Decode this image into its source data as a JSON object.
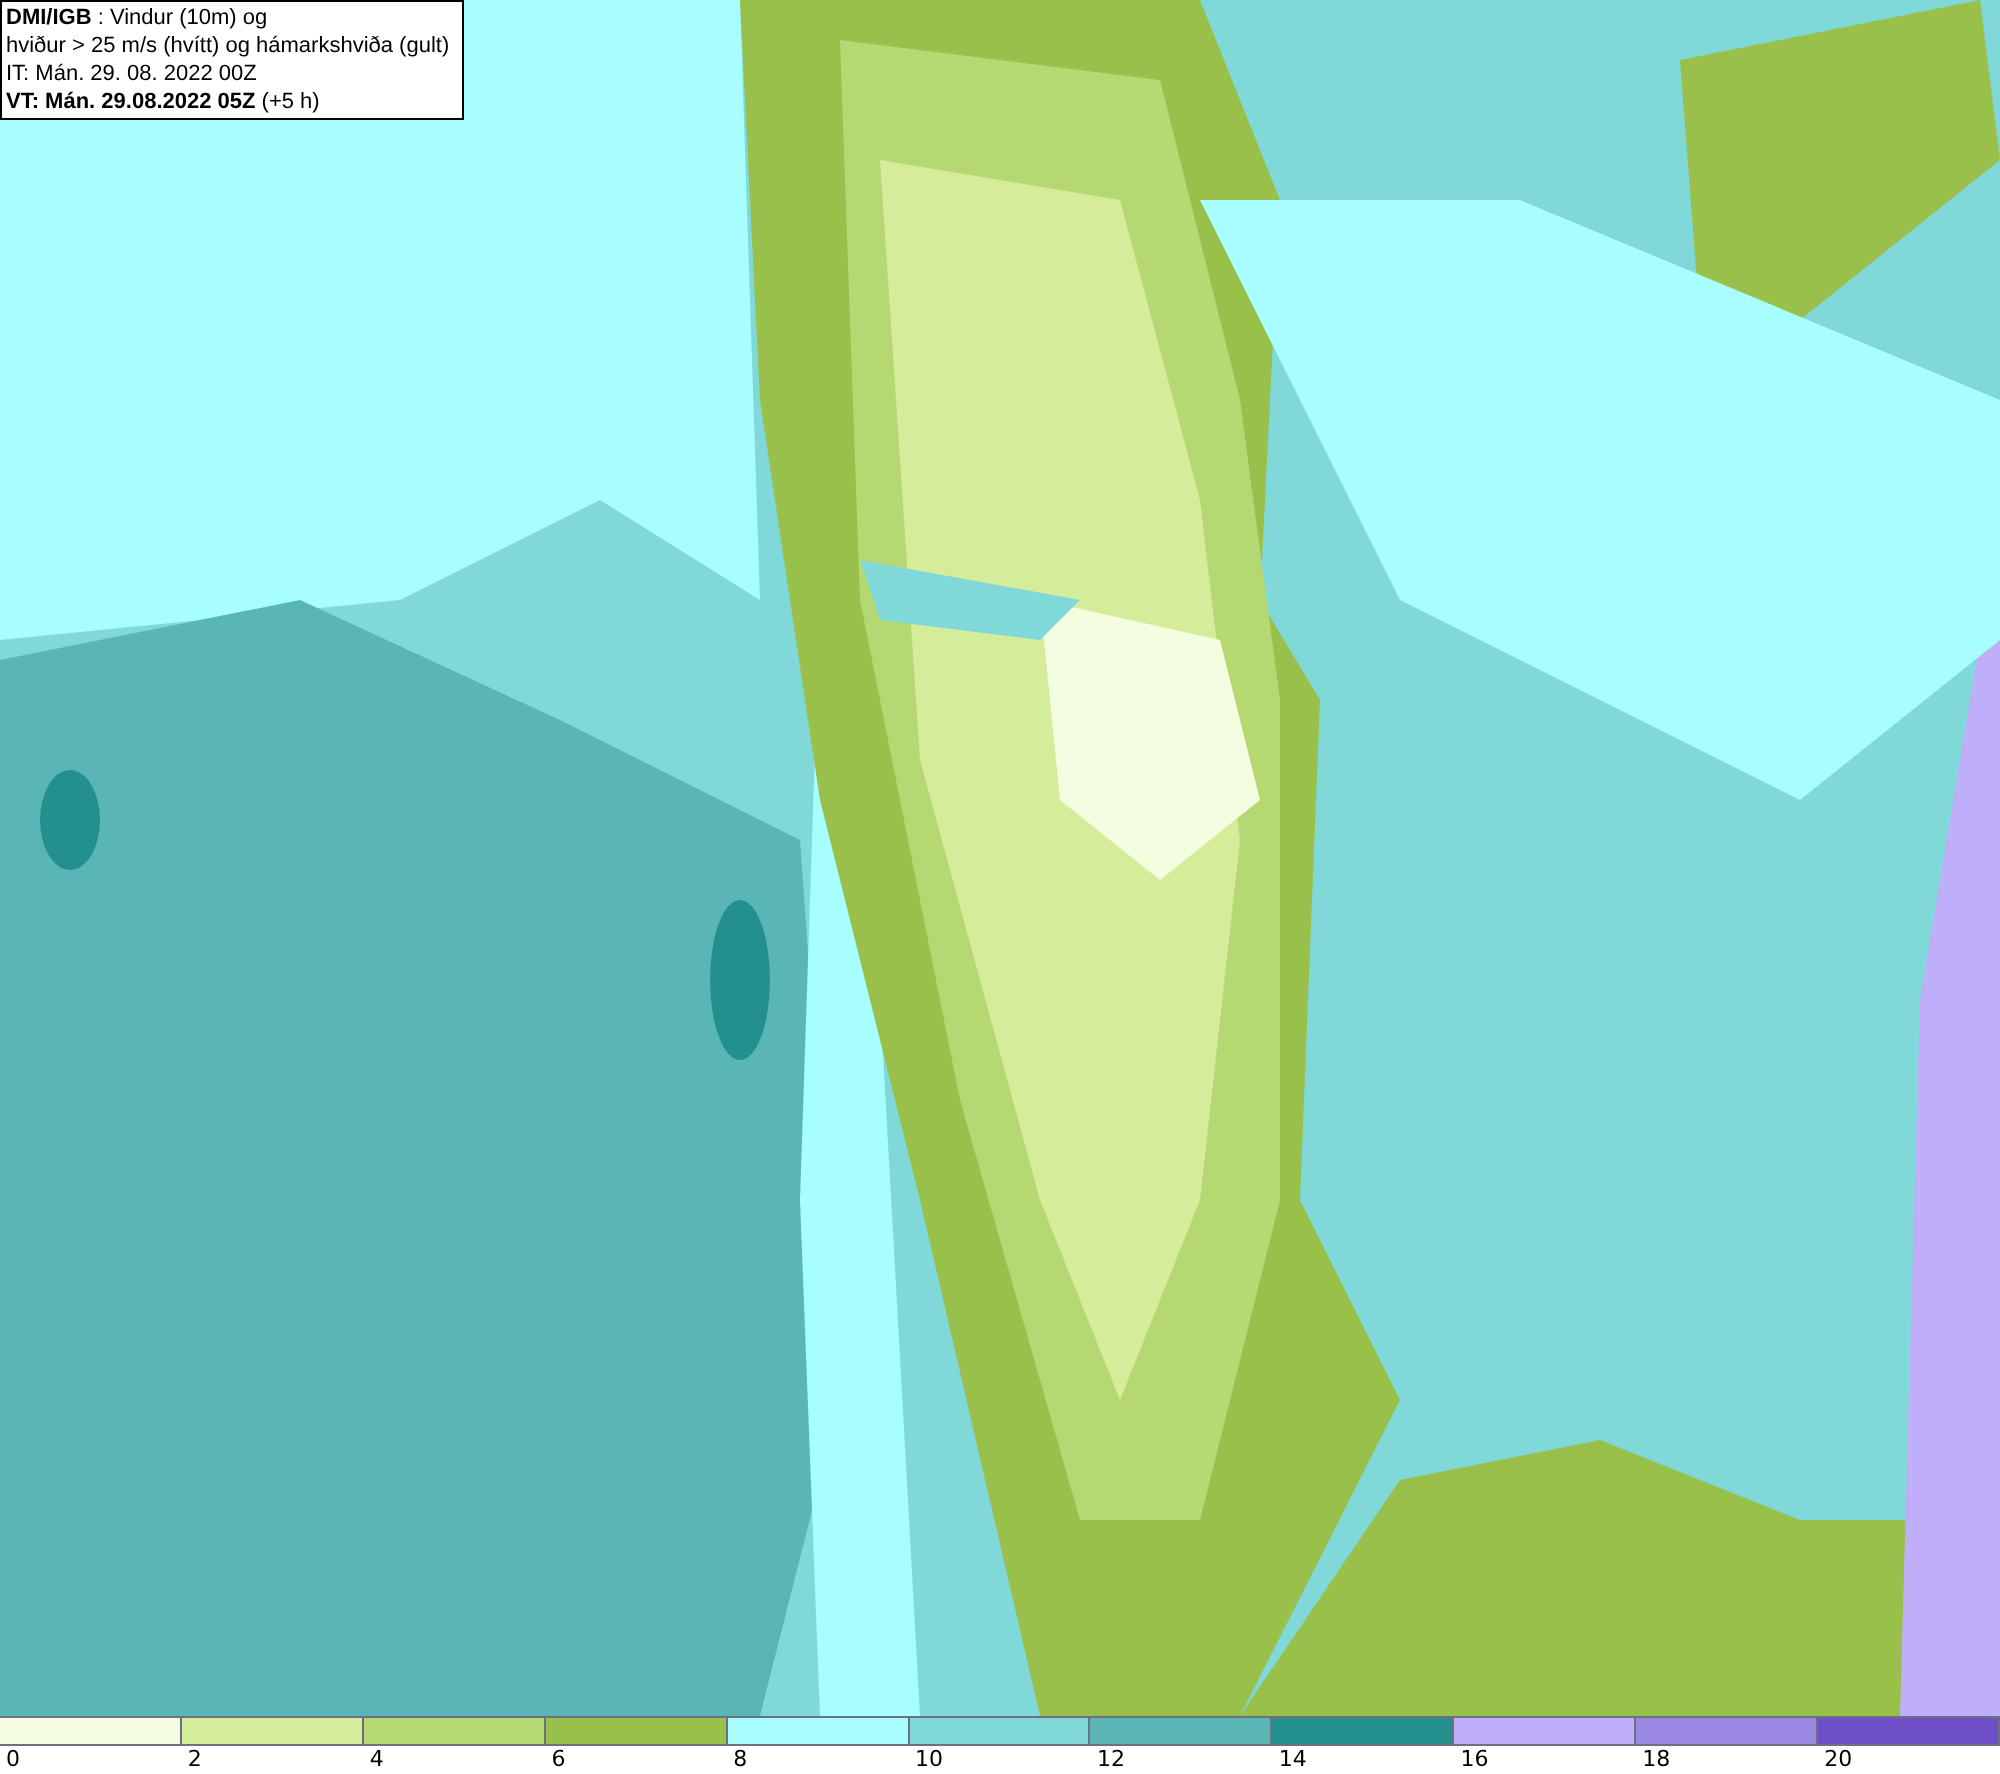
{
  "info_box": {
    "lines": [
      "**DMI/IGB** : Vindur (10m) og",
      "hviður > 25 m/s (hvítt) og hámarkshviða (gult)",
      "IT: Mán. 29. 08. 2022 00Z",
      "**VT: Mán. 29.08.2022 05Z** (+5 h)"
    ]
  },
  "color_scale": {
    "bins": [
      {
        "color": "#f5fde0"
      },
      {
        "color": "#d5ec9a"
      },
      {
        "color": "#b5d872"
      },
      {
        "color": "#98c04a"
      },
      {
        "color": "#a8fefe"
      },
      {
        "color": "#80d8d8"
      },
      {
        "color": "#5ab6b6"
      },
      {
        "color": "#24908e"
      },
      {
        "color": "#c0aefa"
      },
      {
        "color": "#9a88e2"
      },
      {
        "color": "#7050c8"
      }
    ],
    "ticks": [
      "0",
      "2",
      "4",
      "6",
      "8",
      "10",
      "12",
      "14",
      "16",
      "18",
      "20"
    ]
  }
}
